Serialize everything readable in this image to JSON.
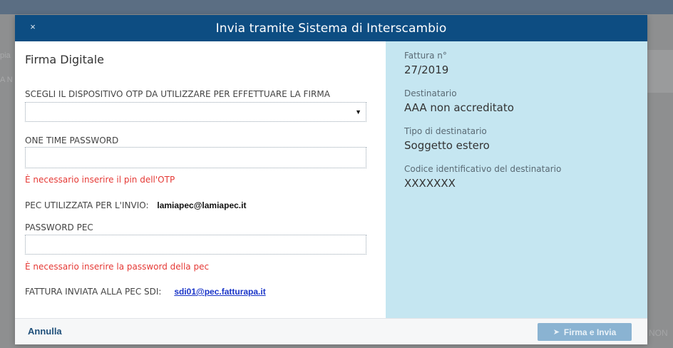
{
  "modal": {
    "title": "Invia tramite Sistema di Interscambio",
    "close_glyph": "×"
  },
  "background": {
    "left_fragment_1": "pia",
    "left_fragment_2": "A N",
    "right_fragment": "NON"
  },
  "form": {
    "section_title": "Firma Digitale",
    "otp_device_label": "SCEGLI IL DISPOSITIVO OTP DA UTILIZZARE PER EFFETTUARE LA FIRMA",
    "otp_device_value": "",
    "otp_label": "ONE TIME PASSWORD",
    "otp_value": "",
    "otp_error": "È necessario inserire il pin dell'OTP",
    "pec_used_label": "PEC UTILIZZATA PER L'INVIO:",
    "pec_used_value": "lamiapec@lamiapec.it",
    "pec_password_label": "PASSWORD PEC",
    "pec_password_value": "",
    "pec_password_error": "È necessario inserire la password della pec",
    "sdi_label": "FATTURA INVIATA ALLA PEC SDI:",
    "sdi_value": "sdi01@pec.fatturapa.it"
  },
  "info": {
    "invoice_label": "Fattura n°",
    "invoice_value": "27/2019",
    "recipient_label": "Destinatario",
    "recipient_value": "AAA non accreditato",
    "recipient_type_label": "Tipo di destinatario",
    "recipient_type_value": "Soggetto estero",
    "recipient_code_label": "Codice identificativo del destinatario",
    "recipient_code_value": "XXXXXXX"
  },
  "footer": {
    "cancel_label": "Annulla",
    "submit_label": "Firma e Invia",
    "submit_icon": "send-icon"
  },
  "colors": {
    "header": "#0d4d82",
    "info_panel": "#c5e6f1",
    "error": "#e53935",
    "link": "#1a35c8",
    "submit_button": "#8ab3d2"
  }
}
